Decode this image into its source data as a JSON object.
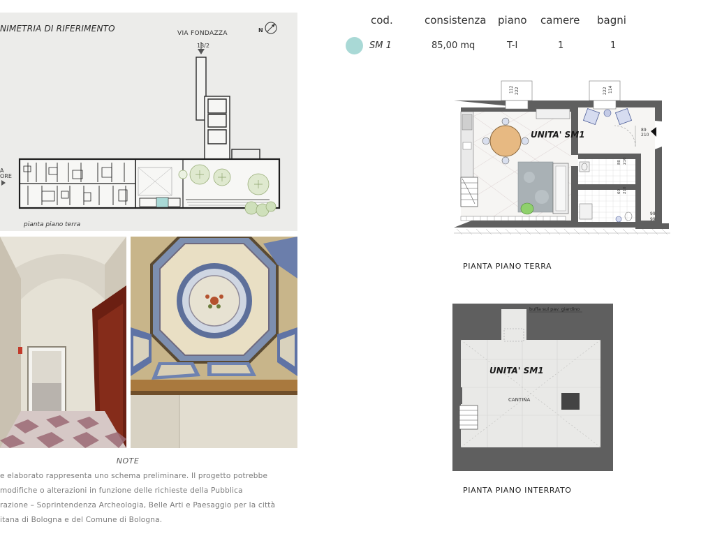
{
  "site_plan": {
    "title": "NIMETRIA DI RIFERIMENTO",
    "street": "VIA FONDAZZA",
    "street_number": "13/2",
    "north_label": "N",
    "caption": "pianta piano terra",
    "cut_label_1": "A",
    "cut_label_2": "ORE"
  },
  "table": {
    "headers": [
      "cod.",
      "consistenza",
      "piano",
      "camere",
      "bagni"
    ],
    "row": {
      "swatch_color": "#a9d9d6",
      "cod": "SM 1",
      "consistenza": "85,00 mq",
      "piano": "T-I",
      "camere": "1",
      "bagni": "1"
    }
  },
  "ground_plan": {
    "unit_label": "UNITA' SM1",
    "caption": "PIANTA PIANO TERRA",
    "dims": [
      "112",
      "222",
      "114",
      "222",
      "89",
      "210",
      "80",
      "210",
      "60",
      "210",
      "99",
      "99"
    ]
  },
  "basement_plan": {
    "unit_label": "UNITA' SM1",
    "room_label": "CANTINA",
    "note": "buffa sul pav. giardino",
    "caption": "PIANTA PIANO INTERRATO"
  },
  "notes": {
    "title": "NOTE",
    "lines": [
      "e elaborato rappresenta uno schema preliminare. Il progetto potrebbe",
      "modifiche   o   alterazioni   in   funzione   delle   richieste   della   Pubblica",
      "razione – Soprintendenza Archeologia, Belle Arti e Paesaggio per la città",
      "itana di Bologna e del Comune di Bologna."
    ]
  },
  "colors": {
    "wall": "#5f5f5f",
    "plan_bg": "#ececea",
    "accent_teal": "#a9d9d6"
  }
}
